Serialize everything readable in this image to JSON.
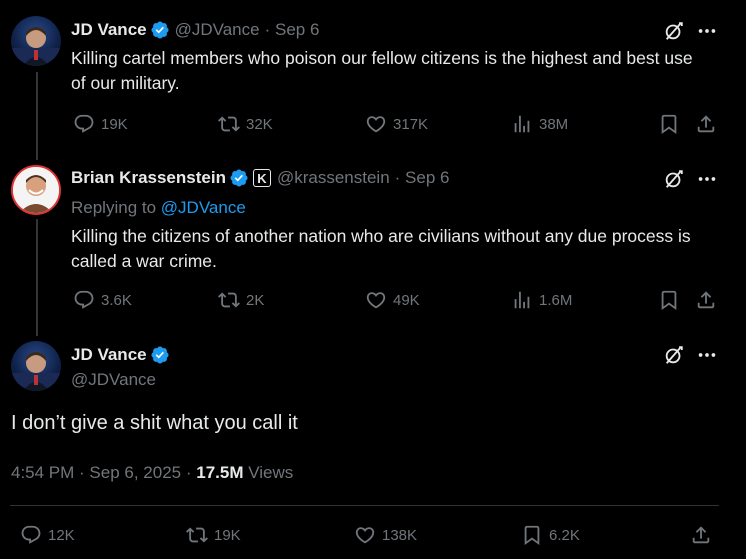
{
  "tweet1": {
    "author": "JD Vance",
    "handle": "@JDVance",
    "date": "· Sep 6",
    "text": "Killing cartel members who poison our fellow citizens is the highest and best use of our military.",
    "replies": "19K",
    "reposts": "32K",
    "likes": "317K",
    "views": "38M"
  },
  "tweet2": {
    "author": "Brian Krassenstein",
    "affiliate_badge": "K",
    "handle": "@krassenstein",
    "date": "· Sep 6",
    "replying_prefix": "Replying to",
    "replying_to": "@JDVance",
    "text": "Killing the citizens of another nation who are civilians without any due process is called a war crime.",
    "replies": "3.6K",
    "reposts": "2K",
    "likes": "49K",
    "views": "1.6M"
  },
  "main_tweet": {
    "author": "JD Vance",
    "handle": "@JDVance",
    "text": "I don’t give a shit what you call it",
    "timestamp": "4:54 PM · Sep 6, 2025 ·",
    "views_count": "17.5M",
    "views_label": "Views",
    "replies": "12K",
    "reposts": "19K",
    "likes": "138K",
    "bookmarks": "6.2K"
  },
  "colors": {
    "background": "#000000",
    "text": "#e7e9ea",
    "muted": "#71767b",
    "link": "#1d9bf0",
    "verified": "#1d9bf0"
  },
  "icons": [
    "reply-icon",
    "repost-icon",
    "like-icon",
    "views-icon",
    "bookmark-icon",
    "share-icon",
    "grok-icon",
    "more-icon",
    "verified-icon"
  ]
}
